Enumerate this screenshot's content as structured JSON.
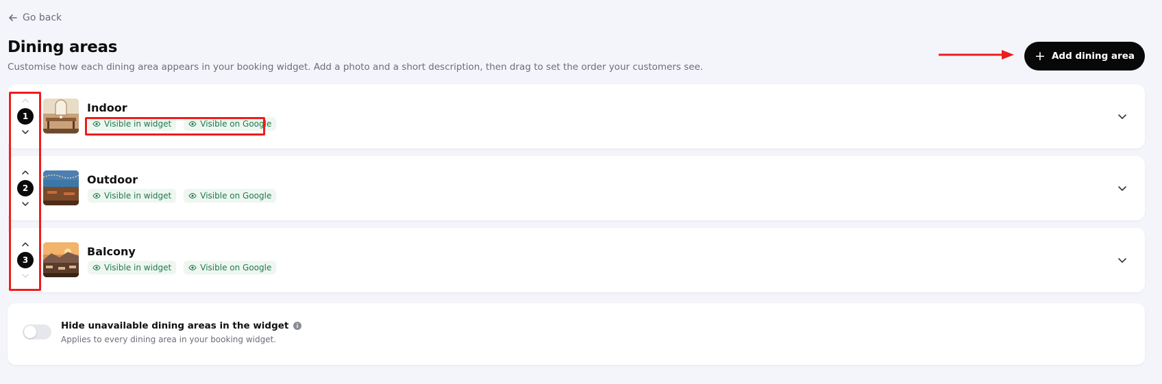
{
  "nav": {
    "go_back_label": "Go back"
  },
  "header": {
    "title": "Dining areas",
    "subtitle": "Customise how each dining area appears in your booking widget. Add a photo and a short description, then drag to set the order your customers see.",
    "add_button_label": "Add dining area"
  },
  "areas": [
    {
      "order": "1",
      "name": "Indoor",
      "badge_widget": "Visible in widget",
      "badge_google": "Visible on Google"
    },
    {
      "order": "2",
      "name": "Outdoor",
      "badge_widget": "Visible in widget",
      "badge_google": "Visible on Google"
    },
    {
      "order": "3",
      "name": "Balcony",
      "badge_widget": "Visible in widget",
      "badge_google": "Visible on Google"
    }
  ],
  "settings": {
    "hide_unavailable_title": "Hide unavailable dining areas in the widget",
    "hide_unavailable_desc": "Applies to every dining area in your booking widget.",
    "hide_unavailable_enabled": false
  },
  "colors": {
    "background": "#f4f5fa",
    "primary_button": "#080808",
    "badge_text": "#1f7a4a",
    "badge_bg": "#eef6f0",
    "annotation_red": "#ee1c1c"
  },
  "icons": {
    "back": "arrow-left-icon",
    "add": "plus-icon",
    "reorder_up": "chevron-up-icon",
    "reorder_down": "chevron-down-icon",
    "visibility": "eye-icon",
    "expand": "chevron-down-icon",
    "info": "info-icon"
  }
}
